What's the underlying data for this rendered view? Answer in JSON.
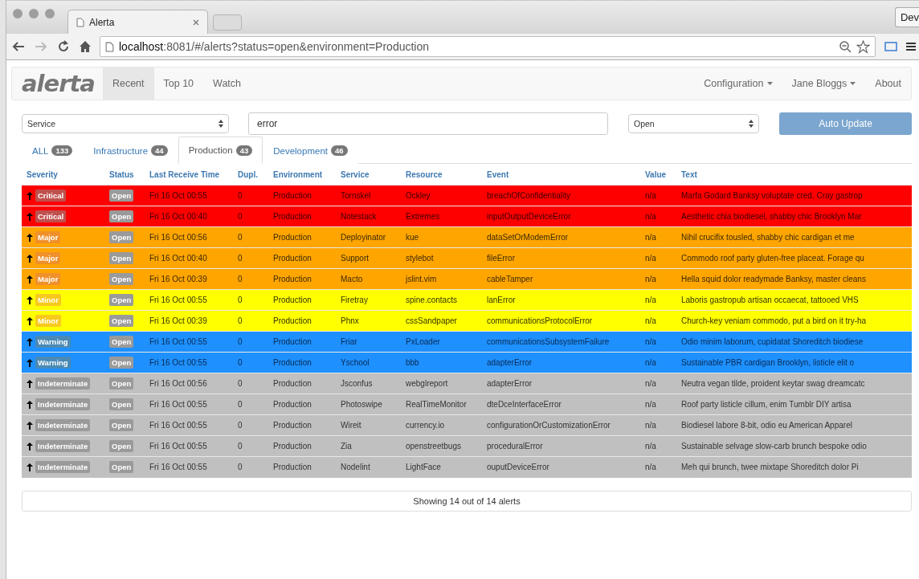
{
  "browser": {
    "tab_title": "Alerta",
    "address_host": "localhost",
    "address_path": ":8081/#/alerts?status=open&environment=Production",
    "profile_button": "Dev"
  },
  "navbar": {
    "brand": "alerta",
    "left": [
      {
        "label": "Recent",
        "selected": true
      },
      {
        "label": "Top 10",
        "selected": false
      },
      {
        "label": "Watch",
        "selected": false
      }
    ],
    "right": [
      {
        "label": "Configuration",
        "dropdown": true
      },
      {
        "label": "Jane Bloggs",
        "dropdown": true
      },
      {
        "label": "About",
        "dropdown": false
      }
    ]
  },
  "filters": {
    "service_select": "Service",
    "search": "error",
    "status_select": "Open",
    "auto_update_button": "Auto Update"
  },
  "tabs": [
    {
      "label": "ALL",
      "count": "133",
      "selected": false
    },
    {
      "label": "Infrastructure",
      "count": "44",
      "selected": false
    },
    {
      "label": "Production",
      "count": "43",
      "selected": true
    },
    {
      "label": "Development",
      "count": "46",
      "selected": false
    }
  ],
  "table": {
    "columns": [
      "Severity",
      "Status",
      "Last Receive Time",
      "Dupl.",
      "Environment",
      "Service",
      "Resource",
      "Event",
      "Value",
      "Text"
    ],
    "rows": [
      {
        "kind": "critical",
        "color": "#ff0000",
        "severity": "Critical",
        "status": "Open",
        "time": "Fri 16 Oct 00:55",
        "dupl": "0",
        "environment": "Production",
        "service": "Tornskel",
        "resource": "Ockley",
        "event": "breachOfConfidentiality",
        "value": "n/a",
        "text": "Marfa Godard Banksy voluptate cred. Cray gastrop"
      },
      {
        "kind": "critical",
        "color": "#ff0000",
        "severity": "Critical",
        "status": "Open",
        "time": "Fri 16 Oct 00:40",
        "dupl": "0",
        "environment": "Production",
        "service": "Notestack",
        "resource": "Extremes",
        "event": "inputOutputDeviceError",
        "value": "n/a",
        "text": "Aesthetic chia biodiesel, shabby chic Brooklyn Mar"
      },
      {
        "kind": "major",
        "color": "#ffa500",
        "severity": "Major",
        "status": "Open",
        "time": "Fri 16 Oct 00:56",
        "dupl": "0",
        "environment": "Production",
        "service": "Deployinator",
        "resource": "kue",
        "event": "dataSetOrModemError",
        "value": "n/a",
        "text": "Nihil crucifix tousled, shabby chic cardigan et me"
      },
      {
        "kind": "major",
        "color": "#ffa500",
        "severity": "Major",
        "status": "Open",
        "time": "Fri 16 Oct 00:40",
        "dupl": "0",
        "environment": "Production",
        "service": "Support",
        "resource": "stylebot",
        "event": "fileError",
        "value": "n/a",
        "text": "Commodo roof party gluten-free placeat. Forage qu"
      },
      {
        "kind": "major",
        "color": "#ffa500",
        "severity": "Major",
        "status": "Open",
        "time": "Fri 16 Oct 00:39",
        "dupl": "0",
        "environment": "Production",
        "service": "Macto",
        "resource": "jslint.vim",
        "event": "cableTamper",
        "value": "n/a",
        "text": "Hella squid dolor readymade Banksy, master cleans"
      },
      {
        "kind": "minor",
        "color": "#ffff00",
        "severity": "Minor",
        "status": "Open",
        "time": "Fri 16 Oct 00:55",
        "dupl": "0",
        "environment": "Production",
        "service": "Firetray",
        "resource": "spine.contacts",
        "event": "lanError",
        "value": "n/a",
        "text": "Laboris gastropub artisan occaecat, tattooed VHS"
      },
      {
        "kind": "minor",
        "color": "#ffff00",
        "severity": "Minor",
        "status": "Open",
        "time": "Fri 16 Oct 00:39",
        "dupl": "0",
        "environment": "Production",
        "service": "Phnx",
        "resource": "cssSandpaper",
        "event": "communicationsProtocolError",
        "value": "n/a",
        "text": "Church-key veniam commodo, put a bird on it try-ha"
      },
      {
        "kind": "warning",
        "color": "#1e90ff",
        "severity": "Warning",
        "status": "Open",
        "time": "Fri 16 Oct 00:55",
        "dupl": "0",
        "environment": "Production",
        "service": "Friar",
        "resource": "PxLoader",
        "event": "communicationsSubsystemFailure",
        "value": "n/a",
        "text": "Odio minim laborum, cupidatat Shoreditch biodiese"
      },
      {
        "kind": "warning",
        "color": "#1e90ff",
        "severity": "Warning",
        "status": "Open",
        "time": "Fri 16 Oct 00:55",
        "dupl": "0",
        "environment": "Production",
        "service": "Yschool",
        "resource": "bbb",
        "event": "adapterError",
        "value": "n/a",
        "text": "Sustainable PBR cardigan Brooklyn, listicle elit o"
      },
      {
        "kind": "indeterminate",
        "color": "#c0c0c0",
        "severity": "Indeterminate",
        "status": "Open",
        "time": "Fri 16 Oct 00:56",
        "dupl": "0",
        "environment": "Production",
        "service": "Jsconfus",
        "resource": "webglreport",
        "event": "adapterError",
        "value": "n/a",
        "text": "Neutra vegan tilde, proident keytar swag dreamcatc"
      },
      {
        "kind": "indeterminate",
        "color": "#c0c0c0",
        "severity": "Indeterminate",
        "status": "Open",
        "time": "Fri 16 Oct 00:55",
        "dupl": "0",
        "environment": "Production",
        "service": "Photoswipe",
        "resource": "RealTimeMonitor",
        "event": "dteDceInterfaceError",
        "value": "n/a",
        "text": "Roof party listicle cillum, enim Tumblr DIY artisa"
      },
      {
        "kind": "indeterminate",
        "color": "#c0c0c0",
        "severity": "Indeterminate",
        "status": "Open",
        "time": "Fri 16 Oct 00:55",
        "dupl": "0",
        "environment": "Production",
        "service": "Wireit",
        "resource": "currency.io",
        "event": "configurationOrCustomizationError",
        "value": "n/a",
        "text": "Biodiesel labore 8-bit, odio eu American Apparel"
      },
      {
        "kind": "indeterminate",
        "color": "#c0c0c0",
        "severity": "Indeterminate",
        "status": "Open",
        "time": "Fri 16 Oct 00:55",
        "dupl": "0",
        "environment": "Production",
        "service": "Zia",
        "resource": "openstreetbugs",
        "event": "proceduralError",
        "value": "n/a",
        "text": "Sustainable selvage slow-carb brunch bespoke odio"
      },
      {
        "kind": "indeterminate",
        "color": "#c0c0c0",
        "severity": "Indeterminate",
        "status": "Open",
        "time": "Fri 16 Oct 00:55",
        "dupl": "0",
        "environment": "Production",
        "service": "Nodelint",
        "resource": "LightFace",
        "event": "ouputDeviceError",
        "value": "n/a",
        "text": "Meh qui brunch, twee mixtape Shoreditch dolor Pi"
      }
    ]
  },
  "footer": "Showing 14 out of 14 alerts"
}
